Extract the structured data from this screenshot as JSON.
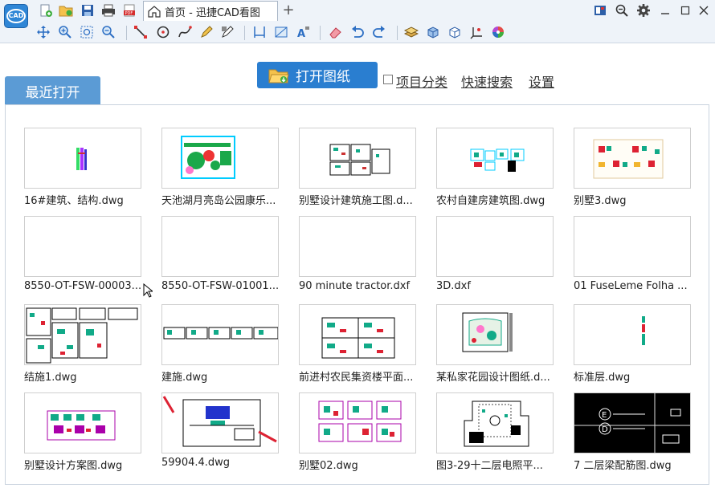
{
  "app": {
    "logo_text": "CAD",
    "accent": "#2a7ed0"
  },
  "quick_access": [
    {
      "icon": "new-file-icon"
    },
    {
      "icon": "open-folder-icon"
    },
    {
      "icon": "save-icon"
    },
    {
      "icon": "print-icon"
    },
    {
      "icon": "pdf-icon"
    }
  ],
  "tabs": [
    {
      "label": "首页 - 迅捷CAD看图",
      "icon": "home-icon"
    }
  ],
  "tab_add": "+",
  "window_controls": [
    {
      "icon": "layout-icon"
    },
    {
      "icon": "zoom-icon"
    },
    {
      "icon": "settings-gear-icon"
    },
    {
      "icon": "minimize-icon"
    },
    {
      "icon": "maximize-icon"
    },
    {
      "icon": "close-icon"
    }
  ],
  "toolbar": [
    {
      "icon": "pan-icon"
    },
    {
      "icon": "zoom-in-icon"
    },
    {
      "icon": "zoom-window-icon"
    },
    {
      "icon": "zoom-out-icon"
    },
    {
      "icon": "line-icon"
    },
    {
      "icon": "circle-icon"
    },
    {
      "icon": "curve-icon"
    },
    {
      "icon": "pencil-icon"
    },
    {
      "icon": "text-edit-icon"
    },
    {
      "icon": "measure-icon"
    },
    {
      "icon": "area-icon"
    },
    {
      "icon": "text-style-icon"
    },
    {
      "icon": "eraser-icon"
    },
    {
      "icon": "undo-icon"
    },
    {
      "icon": "redo-icon"
    },
    {
      "icon": "layer-icon"
    },
    {
      "icon": "3d-box-icon"
    },
    {
      "icon": "3d-view-icon"
    },
    {
      "icon": "axis-icon"
    },
    {
      "icon": "color-wheel-icon"
    }
  ],
  "actions": {
    "open_button": "打开图纸",
    "category_checkbox_label": "项目分类",
    "quick_search": "快速搜索",
    "settings": "设置"
  },
  "recent": {
    "tab_label": "最近打开",
    "files": [
      {
        "name": "16#建筑、结构.dwg",
        "thumb": "tiny"
      },
      {
        "name": "天池湖月亮岛公园康乐...",
        "thumb": "landscape"
      },
      {
        "name": "别墅设计建筑施工图.d...",
        "thumb": "plans"
      },
      {
        "name": "农村自建房建筑图.dwg",
        "thumb": "cyan"
      },
      {
        "name": "别墅3.dwg",
        "thumb": "colorful"
      },
      {
        "name": "8550-OT-FSW-00003...",
        "thumb": "blank"
      },
      {
        "name": "8550-OT-FSW-01001...",
        "thumb": "blank"
      },
      {
        "name": "90 minute tractor.dxf",
        "thumb": "blank"
      },
      {
        "name": "3D.dxf",
        "thumb": "blank"
      },
      {
        "name": "01  FuseLeme  Folha ...",
        "thumb": "blank"
      },
      {
        "name": "结施1.dwg",
        "thumb": "structure"
      },
      {
        "name": "建施.dwg",
        "thumb": "strip"
      },
      {
        "name": "前进村农民集资楼平面...",
        "thumb": "sheet"
      },
      {
        "name": "某私家花园设计图纸.d...",
        "thumb": "garden"
      },
      {
        "name": "标准层.dwg",
        "thumb": "narrow"
      },
      {
        "name": "别墅设计方案图.dwg",
        "thumb": "scheme"
      },
      {
        "name": "59904.4.dwg",
        "thumb": "mech"
      },
      {
        "name": "别墅02.dwg",
        "thumb": "villa"
      },
      {
        "name": "图3-29十二层电照平...",
        "thumb": "electric"
      },
      {
        "name": "7 二层梁配筋图.dwg",
        "thumb": "dark"
      }
    ]
  }
}
